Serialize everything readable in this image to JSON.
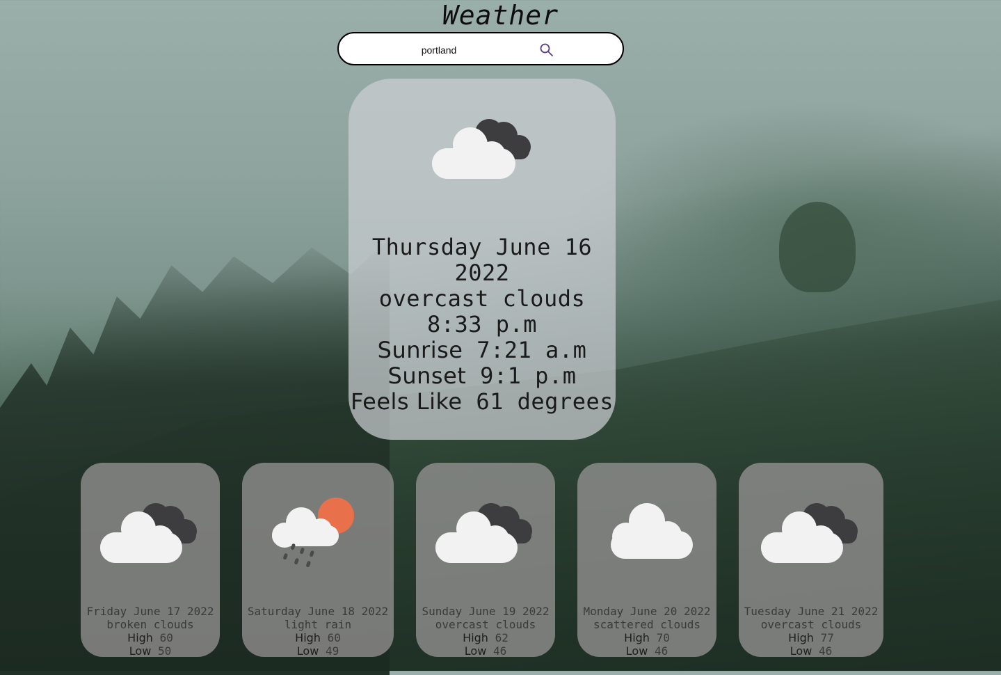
{
  "app": {
    "title": "Weather"
  },
  "search": {
    "value": "portland",
    "icon": "search-icon"
  },
  "current": {
    "icon": "overcast-clouds-icon",
    "date": "Thursday June 16 2022",
    "description": "overcast clouds",
    "time": "8:33 p.m",
    "sunrise_label": "Sunrise",
    "sunrise": "7:21 a.m",
    "sunset_label": "Sunset",
    "sunset": "9:1 p.m",
    "feels_like_label": "Feels Like",
    "feels_like": "61 degrees"
  },
  "forecast": [
    {
      "icon": "broken-clouds-icon",
      "date": "Friday June 17 2022",
      "description": "broken clouds",
      "high_label": "High",
      "high": "60",
      "low_label": "Low",
      "low": "50"
    },
    {
      "icon": "light-rain-icon",
      "date": "Saturday June 18 2022",
      "description": "light rain",
      "high_label": "High",
      "high": "60",
      "low_label": "Low",
      "low": "49"
    },
    {
      "icon": "overcast-clouds-icon",
      "date": "Sunday June 19 2022",
      "description": "overcast clouds",
      "high_label": "High",
      "high": "62",
      "low_label": "Low",
      "low": "46"
    },
    {
      "icon": "scattered-clouds-icon",
      "date": "Monday June 20 2022",
      "description": "scattered clouds",
      "high_label": "High",
      "high": "70",
      "low_label": "Low",
      "low": "46"
    },
    {
      "icon": "overcast-clouds-icon",
      "date": "Tuesday June 21 2022",
      "description": "overcast clouds",
      "high_label": "High",
      "high": "77",
      "low_label": "Low",
      "low": "46"
    }
  ],
  "colors": {
    "cloud_light": "#f2f2f2",
    "cloud_dark": "#3d3d40",
    "sun": "#e8704a",
    "rain": "#4a4a4a",
    "search_icon": "#5a3a8a"
  }
}
